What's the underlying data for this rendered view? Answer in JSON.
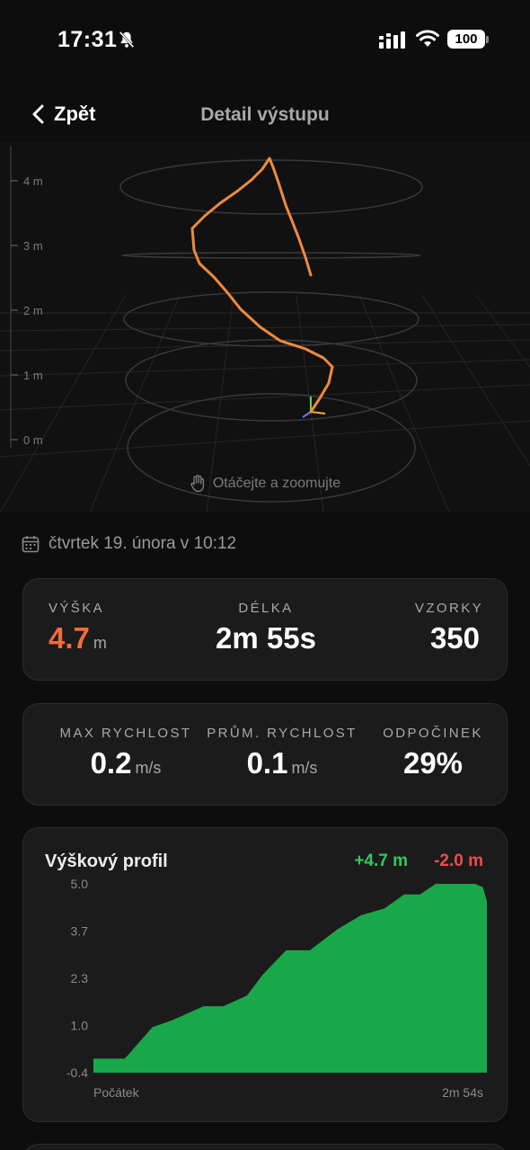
{
  "status_bar": {
    "time": "17:31",
    "battery": "100"
  },
  "nav": {
    "back_label": "Zpět",
    "title": "Detail výstupu"
  },
  "viewer": {
    "axis_labels": [
      "4 m",
      "3 m",
      "2 m",
      "1 m",
      "0 m"
    ],
    "hint": "Otáčejte a zoomujte",
    "path_color": "#f08a3c"
  },
  "session": {
    "date": "čtvrtek 19. února v 10:12"
  },
  "stats_primary": {
    "height": {
      "label": "VÝŠKA",
      "value": "4.7",
      "unit": "m"
    },
    "duration": {
      "label": "DÉLKA",
      "value": "2m 55s"
    },
    "samples": {
      "label": "VZORKY",
      "value": "350"
    }
  },
  "stats_secondary": {
    "max_speed": {
      "label": "MAX RYCHLOST",
      "value": "0.2",
      "unit": "m/s"
    },
    "avg_speed": {
      "label": "PRŮM. RYCHLOST",
      "value": "0.1",
      "unit": "m/s"
    },
    "rest": {
      "label": "ODPOČINEK",
      "value": "29%"
    }
  },
  "colors": {
    "accent": "#f26b3a",
    "gain": "#2ecc5e",
    "loss": "#ef4b4b",
    "area": "#18a84a"
  },
  "profile": {
    "title": "Výškový profil",
    "gain": "+4.7 m",
    "loss": "-2.0 m",
    "x_start": "Počátek",
    "x_end": "2m 54s"
  },
  "chart_data": {
    "type": "area",
    "title": "Výškový profil",
    "xlabel": "",
    "ylabel": "",
    "y_ticks": [
      "5.0",
      "3.7",
      "2.3",
      "1.0",
      "-0.4"
    ],
    "ylim": [
      -0.4,
      5.0
    ],
    "x_range_labels": [
      "Počátek",
      "2m 54s"
    ],
    "x_fraction": [
      0.0,
      0.08,
      0.15,
      0.2,
      0.28,
      0.33,
      0.39,
      0.43,
      0.49,
      0.55,
      0.62,
      0.68,
      0.74,
      0.79,
      0.83,
      0.87,
      0.91,
      0.94,
      0.97,
      0.99,
      1.0
    ],
    "values": [
      0.0,
      0.0,
      0.9,
      1.1,
      1.5,
      1.5,
      1.8,
      2.4,
      3.1,
      3.1,
      3.7,
      4.1,
      4.3,
      4.7,
      4.7,
      5.0,
      5.0,
      5.0,
      5.0,
      4.9,
      4.5
    ]
  }
}
